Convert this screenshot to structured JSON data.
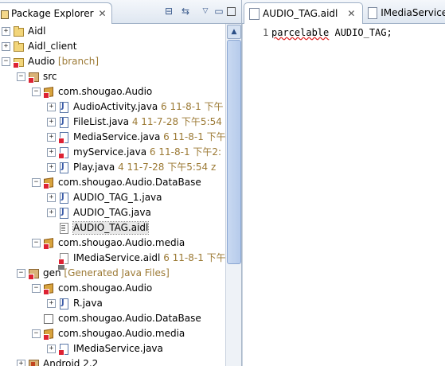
{
  "left_panel": {
    "tab_title": "Package Explorer",
    "close_glyph": "✕",
    "toolbar": {
      "collapse_glyph": "⊟",
      "link_glyph": "⇆",
      "menu_glyph": "▽",
      "minimize_glyph": "▭"
    }
  },
  "tree": [
    {
      "label": "Aidl",
      "deco": "",
      "expander": "+",
      "icon": "project"
    },
    {
      "label": "Aidl_client",
      "deco": "",
      "expander": "+",
      "icon": "project"
    },
    {
      "label": "Audio",
      "deco": " [branch]",
      "expander": "−",
      "icon": "project"
    },
    {
      "label": "src",
      "deco": "",
      "expander": "−",
      "icon": "src"
    },
    {
      "label": "com.shougao.Audio",
      "deco": "",
      "expander": "−",
      "icon": "pkg"
    },
    {
      "label": "AudioActivity.java",
      "deco": " 6  11-8-1 下午",
      "expander": "+",
      "icon": "java"
    },
    {
      "label": "FileList.java",
      "deco": " 4  11-7-28 下午5:54",
      "expander": "+",
      "icon": "java"
    },
    {
      "label": "MediaService.java",
      "deco": " 6  11-8-1 下午",
      "expander": "+",
      "icon": "java"
    },
    {
      "label": "myService.java",
      "deco": " 6  11-8-1 下午2:",
      "expander": "+",
      "icon": "java"
    },
    {
      "label": "Play.java",
      "deco": " 4  11-7-28 下午5:54  z",
      "expander": "+",
      "icon": "java"
    },
    {
      "label": "com.shougao.Audio.DataBase",
      "deco": "",
      "expander": "−",
      "icon": "pkg"
    },
    {
      "label": "AUDIO_TAG_1.java",
      "deco": "",
      "expander": "+",
      "icon": "java"
    },
    {
      "label": "AUDIO_TAG.java",
      "deco": "",
      "expander": "+",
      "icon": "java"
    },
    {
      "label": "AUDIO_TAG.aidl",
      "deco": "",
      "expander": "",
      "icon": "aidl",
      "selected": true
    },
    {
      "label": "com.shougao.Audio.media",
      "deco": "",
      "expander": "−",
      "icon": "pkg"
    },
    {
      "label": "IMediaService.aidl",
      "deco": " 6  11-8-1 下午",
      "expander": "",
      "icon": "aidl"
    },
    {
      "label": "gen",
      "deco": " [Generated Java Files]",
      "expander": "−",
      "icon": "src"
    },
    {
      "label": "com.shougao.Audio",
      "deco": "",
      "expander": "−",
      "icon": "pkg"
    },
    {
      "label": "R.java",
      "deco": "",
      "expander": "+",
      "icon": "java"
    },
    {
      "label": "com.shougao.Audio.DataBase",
      "deco": "",
      "expander": "",
      "icon": "pkg-empty"
    },
    {
      "label": "com.shougao.Audio.media",
      "deco": "",
      "expander": "−",
      "icon": "pkg"
    },
    {
      "label": "IMediaService.java",
      "deco": "",
      "expander": "+",
      "icon": "java"
    },
    {
      "label": "Android 2.2",
      "deco": "",
      "expander": "+",
      "icon": "src"
    }
  ],
  "editor": {
    "tabs": [
      {
        "title": "AUDIO_TAG.aidl",
        "close_glyph": "✕",
        "active": true
      },
      {
        "title": "IMediaService.",
        "active": false
      }
    ],
    "line_number": "1",
    "code_keyword": "parcelable",
    "code_rest": " AUDIO_TAG;"
  },
  "colors": {
    "decoration": "#9c7a35",
    "tab_border": "#9fb0c6",
    "scroll_thumb": "#b6cbeb"
  }
}
